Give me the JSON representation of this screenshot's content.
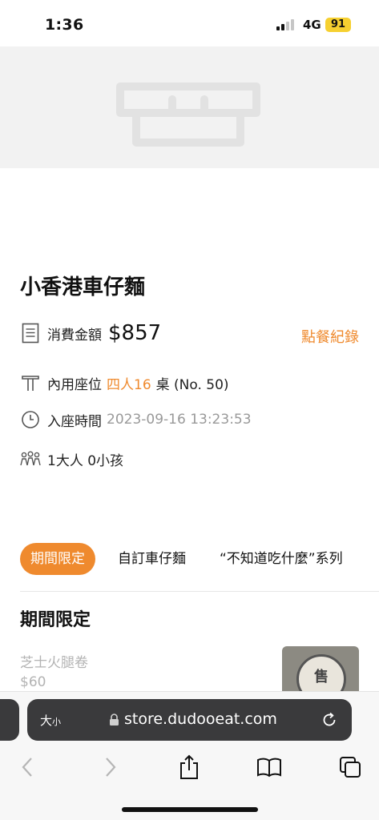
{
  "status_bar": {
    "time": "1:36",
    "network": "4G",
    "battery": "91"
  },
  "restaurant": {
    "name": "小香港車仔麵",
    "amount_label": "消費金額",
    "amount_value": "$857",
    "order_history_link": "點餐紀錄",
    "seat_label": "內用座位",
    "seat_highlight": "四人16",
    "seat_detail": "桌 (No. 50)",
    "checkin_label": "入座時間",
    "checkin_time": "2023-09-16 13:23:53",
    "guests": "1大人 0小孩"
  },
  "tabs": [
    {
      "label": "期間限定",
      "active": true
    },
    {
      "label": "自訂車仔麵",
      "active": false
    },
    {
      "label": "“不知道吃什麼”系列",
      "active": false
    }
  ],
  "section": {
    "title": "期間限定",
    "items": [
      {
        "name": "芝士火腿卷",
        "price": "$60",
        "badge": "售"
      }
    ]
  },
  "browser": {
    "text_size_label": "大",
    "text_size_small": "小",
    "url": "store.dudooeat.com"
  },
  "colors": {
    "accent": "#ef8a2e",
    "battery": "#f6d030",
    "address_bar": "#3a3a3c"
  },
  "icons": [
    "receipt-icon",
    "table-icon",
    "clock-icon",
    "people-icon",
    "lock-icon",
    "reload-icon",
    "back-icon",
    "forward-icon",
    "share-icon",
    "bookmarks-icon",
    "tabs-icon"
  ]
}
